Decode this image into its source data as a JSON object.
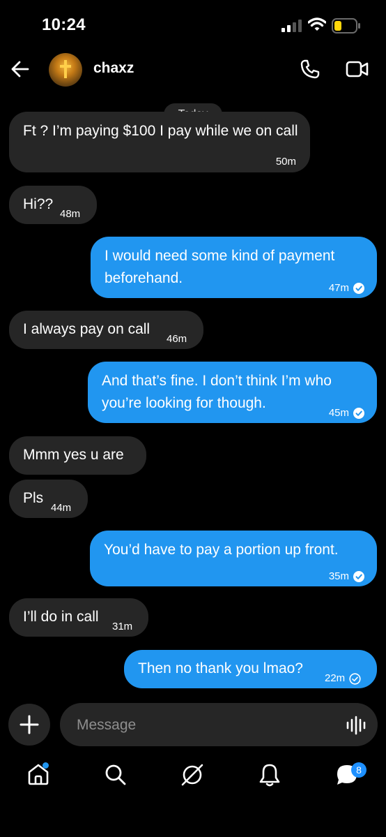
{
  "status_bar": {
    "time": "10:24"
  },
  "header": {
    "contact_name": "chaxz"
  },
  "date_divider": "Today",
  "messages": [
    {
      "direction": "in",
      "text": "Ft ? I’m paying $100 I pay while we on call",
      "time": "50m"
    },
    {
      "direction": "in",
      "text": "Hi??",
      "time": "48m"
    },
    {
      "direction": "out",
      "text": "I would need some kind of payment beforehand.",
      "time": "47m",
      "status": "seen"
    },
    {
      "direction": "in",
      "text": "I always pay on call",
      "time": "46m"
    },
    {
      "direction": "out",
      "text": "And that’s fine. I don’t think I’m who you’re looking for though.",
      "time": "45m",
      "status": "seen"
    },
    {
      "direction": "in",
      "text": "Mmm yes u are",
      "time": ""
    },
    {
      "direction": "in",
      "text": "Pls",
      "time": "44m"
    },
    {
      "direction": "out",
      "text": "You’d have to pay a portion up front.",
      "time": "35m",
      "status": "seen"
    },
    {
      "direction": "in",
      "text": "I’ll do in call",
      "time": "31m"
    },
    {
      "direction": "out",
      "text": "Then no thank you lmao?",
      "time": "22m",
      "status": "sent"
    }
  ],
  "composer": {
    "placeholder": "Message"
  },
  "tabbar": {
    "messages_badge": "8"
  },
  "colors": {
    "outgoing": "#2196f0",
    "incoming": "#262626",
    "background": "#000000"
  },
  "icons": [
    "back-arrow-icon",
    "phone-icon",
    "video-icon",
    "plus-icon",
    "voice-wave-icon",
    "home-icon",
    "search-icon",
    "explore-icon",
    "bell-icon",
    "chat-icon"
  ]
}
